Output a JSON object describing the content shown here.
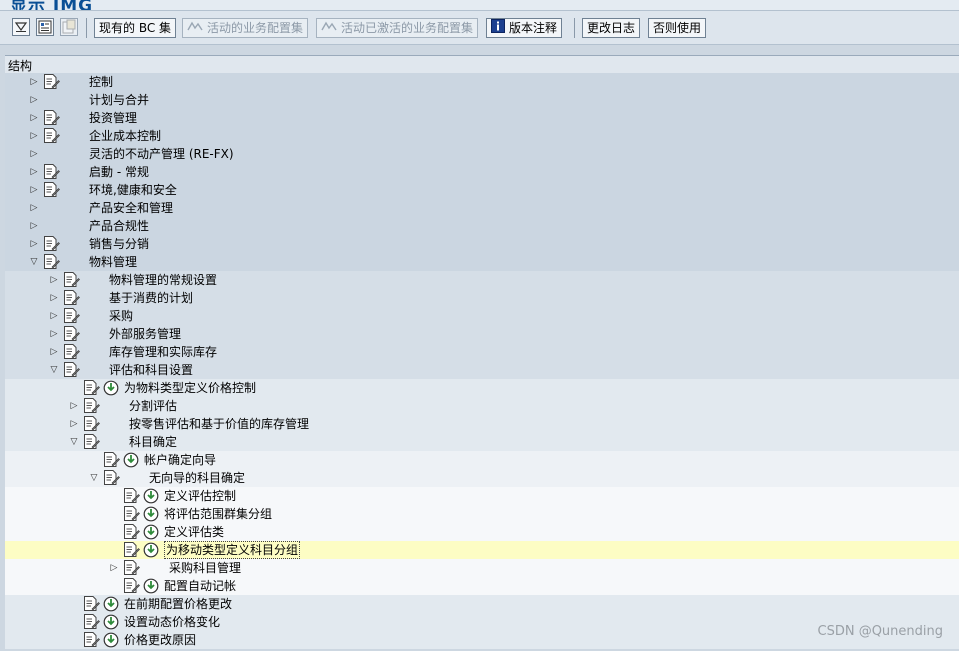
{
  "window": {
    "title": "显示 IMG"
  },
  "toolbar": {
    "buttons": [
      {
        "label": "现有的 BC 集",
        "enabled": true
      },
      {
        "label": "活动的业务配置集",
        "enabled": false
      },
      {
        "label": "活动已激活的业务配置集",
        "enabled": false
      },
      {
        "label": "版本注释",
        "enabled": true
      },
      {
        "label": "更改日志",
        "enabled": true
      },
      {
        "label": "否则使用",
        "enabled": true
      }
    ]
  },
  "tree": {
    "column_header": "结构",
    "rows": [
      {
        "label": "控制",
        "level": 0,
        "expander": "collapsed",
        "doc": true,
        "exec": false
      },
      {
        "label": "计划与合并",
        "level": 0,
        "expander": "collapsed",
        "doc": false,
        "exec": false
      },
      {
        "label": "投资管理",
        "level": 0,
        "expander": "collapsed",
        "doc": true,
        "exec": false
      },
      {
        "label": "企业成本控制",
        "level": 0,
        "expander": "collapsed",
        "doc": true,
        "exec": false
      },
      {
        "label": "灵活的不动产管理 (RE-FX)",
        "level": 0,
        "expander": "collapsed",
        "doc": false,
        "exec": false
      },
      {
        "label": "启動 - 常规",
        "level": 0,
        "expander": "collapsed",
        "doc": true,
        "exec": false
      },
      {
        "label": "环境,健康和安全",
        "level": 0,
        "expander": "collapsed",
        "doc": true,
        "exec": false
      },
      {
        "label": "产品安全和管理",
        "level": 0,
        "expander": "collapsed",
        "doc": false,
        "exec": false
      },
      {
        "label": "产品合规性",
        "level": 0,
        "expander": "collapsed",
        "doc": false,
        "exec": false
      },
      {
        "label": "销售与分销",
        "level": 0,
        "expander": "collapsed",
        "doc": true,
        "exec": false
      },
      {
        "label": "物料管理",
        "level": 0,
        "expander": "expanded",
        "doc": true,
        "exec": false
      },
      {
        "label": "物料管理的常规设置",
        "level": 1,
        "expander": "collapsed",
        "doc": true,
        "exec": false
      },
      {
        "label": "基于消费的计划",
        "level": 1,
        "expander": "collapsed",
        "doc": true,
        "exec": false
      },
      {
        "label": "采购",
        "level": 1,
        "expander": "collapsed",
        "doc": true,
        "exec": false
      },
      {
        "label": "外部服务管理",
        "level": 1,
        "expander": "collapsed",
        "doc": true,
        "exec": false
      },
      {
        "label": "库存管理和实际库存",
        "level": 1,
        "expander": "collapsed",
        "doc": true,
        "exec": false
      },
      {
        "label": "评估和科目设置",
        "level": 1,
        "expander": "expanded",
        "doc": true,
        "exec": false
      },
      {
        "label": "为物料类型定义价格控制",
        "level": 2,
        "expander": "none",
        "doc": true,
        "exec": true
      },
      {
        "label": "分割评估",
        "level": 2,
        "expander": "collapsed",
        "doc": true,
        "exec": false
      },
      {
        "label": "按零售评估和基于价值的库存管理",
        "level": 2,
        "expander": "collapsed",
        "doc": true,
        "exec": false
      },
      {
        "label": "科目确定",
        "level": 2,
        "expander": "expanded",
        "doc": true,
        "exec": false
      },
      {
        "label": "帐户确定向导",
        "level": 3,
        "expander": "none",
        "doc": true,
        "exec": true
      },
      {
        "label": "无向导的科目确定",
        "level": 3,
        "expander": "expanded",
        "doc": true,
        "exec": false
      },
      {
        "label": "定义评估控制",
        "level": 4,
        "expander": "none",
        "doc": true,
        "exec": true
      },
      {
        "label": "将评估范围群集分组",
        "level": 4,
        "expander": "none",
        "doc": true,
        "exec": true
      },
      {
        "label": "定义评估类",
        "level": 4,
        "expander": "none",
        "doc": true,
        "exec": true
      },
      {
        "label": "为移动类型定义科目分组",
        "level": 4,
        "expander": "none",
        "doc": true,
        "exec": true,
        "selected": true
      },
      {
        "label": "采购科目管理",
        "level": 4,
        "expander": "collapsed",
        "doc": true,
        "exec": false
      },
      {
        "label": "配置自动记帐",
        "level": 4,
        "expander": "none",
        "doc": true,
        "exec": true
      },
      {
        "label": "在前期配置价格更改",
        "level": 2,
        "expander": "none",
        "doc": true,
        "exec": true
      },
      {
        "label": "设置动态价格变化",
        "level": 2,
        "expander": "none",
        "doc": true,
        "exec": true
      },
      {
        "label": "价格更改原因",
        "level": 2,
        "expander": "none",
        "doc": true,
        "exec": true
      }
    ]
  },
  "watermark": "CSDN @Qunending",
  "colors": {
    "selected_row": "#fdfdc4",
    "toolbar": "#dde5ed",
    "tree_bg": "#cbd6e1"
  }
}
